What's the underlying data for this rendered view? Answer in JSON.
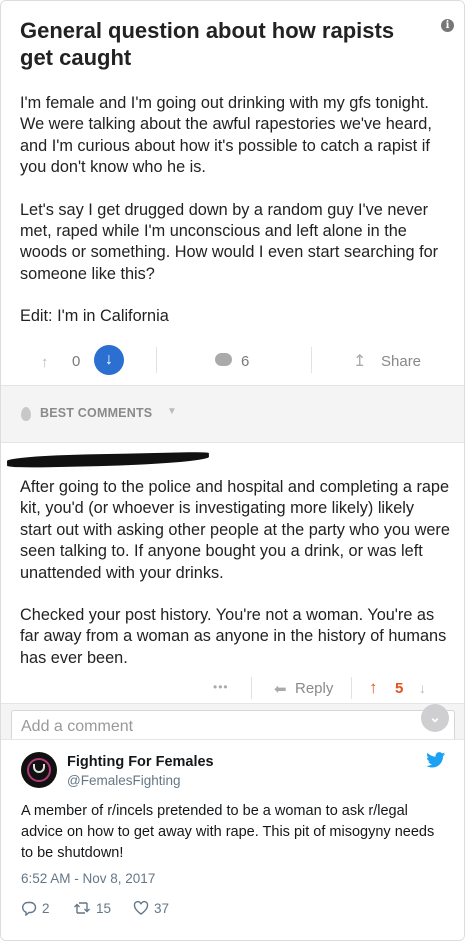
{
  "post": {
    "title": "General question about how rapists get caught",
    "info_symbol": "i",
    "paragraphs": [
      "I'm female and I'm going out drinking with my gfs tonight. We were talking about the awful rapestories we've heard, and I'm curious about how it's possible to catch a rapist if you don't know who he is.",
      "Let's say I get drugged down by a random guy I've never met, raped while I'm unconscious and left alone in the woods or something. How would I even start searching for someone like this?",
      "Edit: I'm in California"
    ],
    "vote_count": "0",
    "comment_count": "6",
    "share_label": "Share"
  },
  "best_comments": {
    "label": "BEST COMMENTS"
  },
  "comment": {
    "paragraphs": [
      "After going to the police and hospital and completing a rape kit, you'd (or whoever is investigating more likely) likely start out with asking other people at the party who you were seen talking to. If anyone bought you a drink, or was left unattended with your drinks.",
      "Checked your post history. You're not a woman. You're as far away from a woman as anyone in the history of humans has ever been."
    ],
    "more_dots": "•••",
    "reply_label": "Reply",
    "score": "5"
  },
  "add_comment": {
    "placeholder": "Add a comment"
  },
  "tweet": {
    "author": "Fighting For Females",
    "handle": "@FemalesFighting",
    "text": "A member of r/incels pretended to be a woman to ask r/legal advice on how to get away with rape. This pit of misogyny needs to be shutdown!",
    "timestamp": "6:52 AM - Nov 8, 2017",
    "replies": "2",
    "retweets": "15",
    "likes": "37"
  },
  "colors": {
    "accent_blue": "#2b6fd0",
    "upvote_orange": "#e0521f",
    "twitter_blue": "#1da1f2"
  }
}
